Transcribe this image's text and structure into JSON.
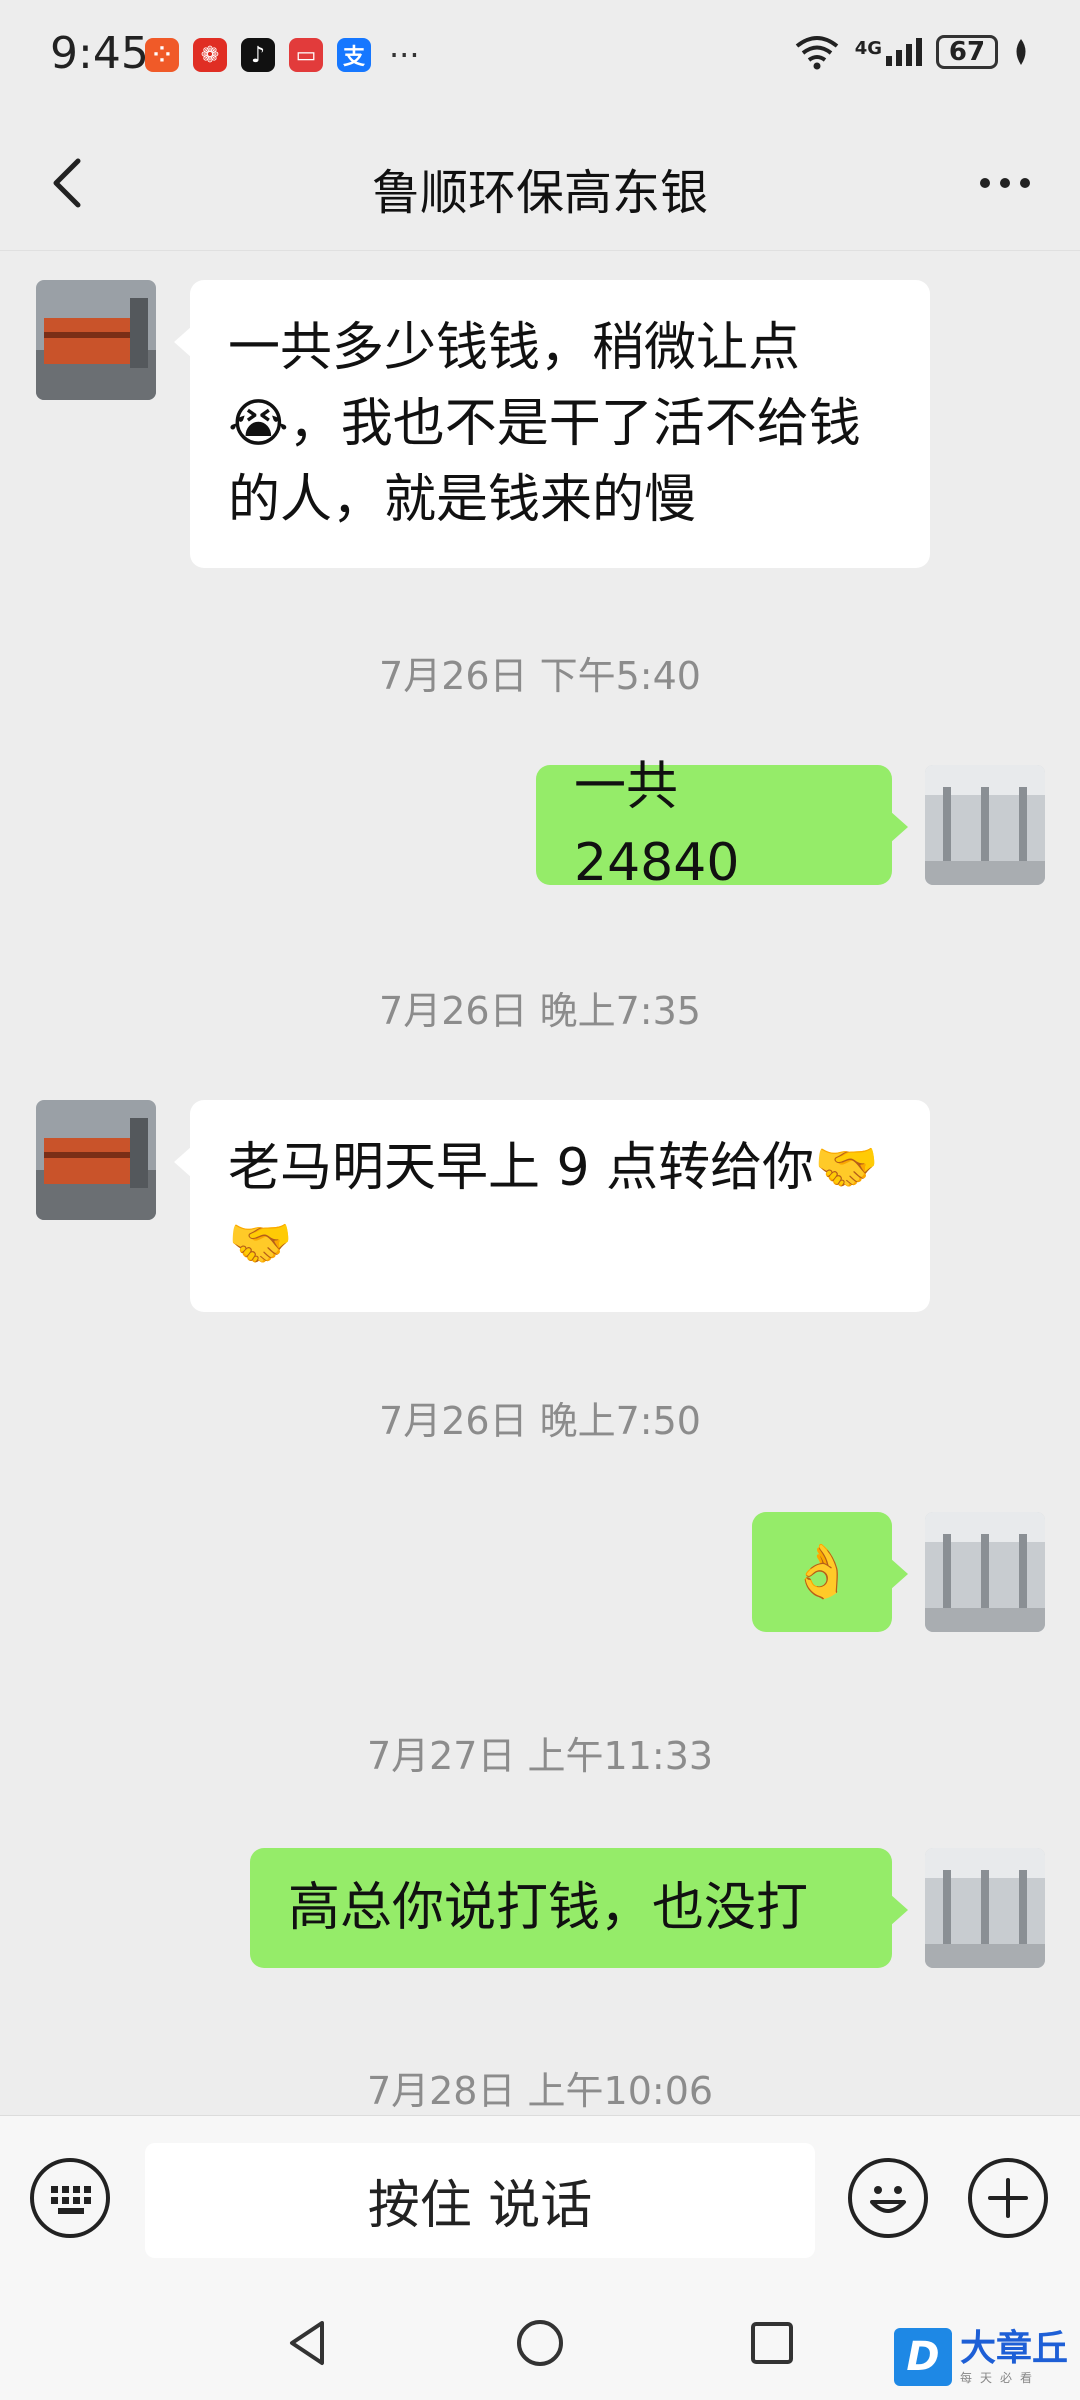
{
  "status_bar": {
    "time": "9:45",
    "app_icons": [
      {
        "name": "xiaohongshu-app-icon",
        "glyph": "⁘",
        "color": "#f05a28"
      },
      {
        "name": "pinduoduo-app-icon",
        "glyph": "❁",
        "color": "#e02e24"
      },
      {
        "name": "douyin-app-icon",
        "glyph": "♪",
        "color": "#111111"
      },
      {
        "name": "red-app-icon",
        "glyph": "▭",
        "color": "#e23b3b"
      },
      {
        "name": "alipay-app-icon",
        "glyph": "支",
        "color": "#1677ff"
      }
    ],
    "more": "···",
    "network": "4G",
    "battery": "67"
  },
  "header": {
    "title": "鲁顺环保高东银"
  },
  "messages": [
    {
      "type": "in",
      "text": "一共多少钱钱，稍微让点😭，我也不是干了活不给钱的人，就是钱来的慢"
    },
    {
      "type": "time",
      "text": "7月26日 下午5:40"
    },
    {
      "type": "out",
      "text": "一共 24840"
    },
    {
      "type": "time",
      "text": "7月26日 晚上7:35"
    },
    {
      "type": "in",
      "text": "老马明天早上 9 点转给你🤝🤝"
    },
    {
      "type": "time",
      "text": "7月26日 晚上7:50"
    },
    {
      "type": "out",
      "text": "👌"
    },
    {
      "type": "time",
      "text": "7月27日 上午11:33"
    },
    {
      "type": "out",
      "text": "高总你说打钱，也没打"
    },
    {
      "type": "time",
      "text": "7月28日 上午10:06"
    }
  ],
  "input_bar": {
    "voice_label": "按住 说话"
  },
  "watermark": {
    "logo": "D",
    "name": "大章丘",
    "tagline": "每天必看"
  },
  "colors": {
    "background": "#ededed",
    "outgoing_bubble": "#95ec69",
    "incoming_bubble": "#ffffff",
    "timestamp": "#8c8c8c"
  }
}
